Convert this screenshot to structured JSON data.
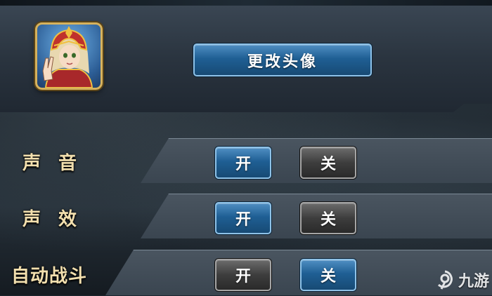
{
  "avatar_panel": {
    "change_avatar_label": "更改头像",
    "avatar_icon": "character-portrait-icon"
  },
  "settings": [
    {
      "label": "声 音",
      "on_label": "开",
      "off_label": "关",
      "selected": "on"
    },
    {
      "label": "声 效",
      "on_label": "开",
      "off_label": "关",
      "selected": "on"
    },
    {
      "label": "自动战斗",
      "on_label": "开",
      "off_label": "关",
      "selected": "off"
    }
  ],
  "watermark": {
    "text": "九游",
    "icon": "9game-logo-icon"
  },
  "colors": {
    "selected_button": "#1f5f94",
    "unselected_button": "#3d3d3d",
    "label_gold": "#f2dfae",
    "avatar_frame": "#d6b25d"
  }
}
